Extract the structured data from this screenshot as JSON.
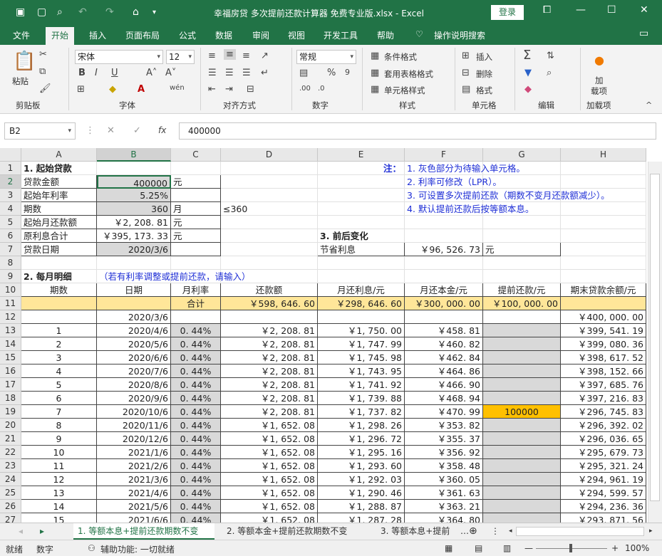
{
  "window": {
    "title": "幸福房贷 多次提前还款计算器 免费专业版.xlsx  -  Excel",
    "login_label": "登录"
  },
  "ribbon_tabs": [
    "文件",
    "开始",
    "插入",
    "页面布局",
    "公式",
    "数据",
    "审阅",
    "视图",
    "开发工具",
    "帮助",
    "操作说明搜索"
  ],
  "ribbon": {
    "paste_label": "粘贴",
    "clipboard_group": "剪贴板",
    "font_name": "宋体",
    "font_size": "12",
    "font_group": "字体",
    "align_group": "对齐方式",
    "number_format": "常规",
    "number_group": "数字",
    "cond_format": "条件格式",
    "table_format": "套用表格格式",
    "cell_style": "单元格样式",
    "style_group": "样式",
    "insert": "插入",
    "delete": "删除",
    "format": "格式",
    "cells_group": "单元格",
    "edit_group": "编辑",
    "addin_line1": "加",
    "addin_line2": "载项",
    "addin_group": "加载项"
  },
  "formula_bar": {
    "name_box": "B2",
    "formula": "400000"
  },
  "columns": [
    "A",
    "B",
    "C",
    "D",
    "E",
    "F",
    "G",
    "H"
  ],
  "rows": [
    {
      "n": "1",
      "a": "1. 起始贷款",
      "e": "注：",
      "f": "1. 灰色部分为待输入单元格。"
    },
    {
      "n": "2",
      "a": "贷款金额",
      "b": "400000",
      "c": "元",
      "f": "2. 利率可修改（LPR）。"
    },
    {
      "n": "3",
      "a": "起始年利率",
      "b": "5.25%",
      "f": "3. 可设置多次提前还款（期数不变月还款额减少）。"
    },
    {
      "n": "4",
      "a": "期数",
      "b": "360",
      "c": "月",
      "d": "≤360",
      "f": "4. 默认提前还款后按等额本息。"
    },
    {
      "n": "5",
      "a": "起始月还款额",
      "b": "￥2, 208. 81",
      "c": "元"
    },
    {
      "n": "6",
      "a": "原利息合计",
      "b": "￥395, 173. 33",
      "c": "元",
      "e": "3. 前后变化"
    },
    {
      "n": "7",
      "a": "贷款日期",
      "b": "2020/3/6",
      "e": "节省利息",
      "f": "￥96, 526. 73",
      "g": "元"
    },
    {
      "n": "8"
    },
    {
      "n": "9",
      "a": "2. 每月明细",
      "b": "（若有利率调整或提前还款，请输入）"
    },
    {
      "n": "10",
      "a": "期数",
      "b": "日期",
      "c": "月利率",
      "d": "还款额",
      "e": "月还利息/元",
      "f": "月还本金/元",
      "g": "提前还款/元",
      "h": "期末贷款余额/元"
    },
    {
      "n": "11",
      "c": "合计",
      "d": "￥598, 646. 60",
      "e": "￥298, 646. 60",
      "f": "￥300, 000. 00",
      "g": "￥100, 000. 00"
    },
    {
      "n": "12",
      "b": "2020/3/6",
      "h": "￥400, 000. 00"
    },
    {
      "n": "13",
      "a": "1",
      "b": "2020/4/6",
      "c": "0. 44%",
      "d": "￥2, 208. 81",
      "e": "￥1, 750. 00",
      "f": "￥458. 81",
      "h": "￥399, 541. 19"
    },
    {
      "n": "14",
      "a": "2",
      "b": "2020/5/6",
      "c": "0. 44%",
      "d": "￥2, 208. 81",
      "e": "￥1, 747. 99",
      "f": "￥460. 82",
      "h": "￥399, 080. 36"
    },
    {
      "n": "15",
      "a": "3",
      "b": "2020/6/6",
      "c": "0. 44%",
      "d": "￥2, 208. 81",
      "e": "￥1, 745. 98",
      "f": "￥462. 84",
      "h": "￥398, 617. 52"
    },
    {
      "n": "16",
      "a": "4",
      "b": "2020/7/6",
      "c": "0. 44%",
      "d": "￥2, 208. 81",
      "e": "￥1, 743. 95",
      "f": "￥464. 86",
      "h": "￥398, 152. 66"
    },
    {
      "n": "17",
      "a": "5",
      "b": "2020/8/6",
      "c": "0. 44%",
      "d": "￥2, 208. 81",
      "e": "￥1, 741. 92",
      "f": "￥466. 90",
      "h": "￥397, 685. 76"
    },
    {
      "n": "18",
      "a": "6",
      "b": "2020/9/6",
      "c": "0. 44%",
      "d": "￥2, 208. 81",
      "e": "￥1, 739. 88",
      "f": "￥468. 94",
      "h": "￥397, 216. 83"
    },
    {
      "n": "19",
      "a": "7",
      "b": "2020/10/6",
      "c": "0. 44%",
      "d": "￥2, 208. 81",
      "e": "￥1, 737. 82",
      "f": "￥470. 99",
      "g": "100000",
      "h": "￥296, 745. 83"
    },
    {
      "n": "20",
      "a": "8",
      "b": "2020/11/6",
      "c": "0. 44%",
      "d": "￥1, 652. 08",
      "e": "￥1, 298. 26",
      "f": "￥353. 82",
      "h": "￥296, 392. 02"
    },
    {
      "n": "21",
      "a": "9",
      "b": "2020/12/6",
      "c": "0. 44%",
      "d": "￥1, 652. 08",
      "e": "￥1, 296. 72",
      "f": "￥355. 37",
      "h": "￥296, 036. 65"
    },
    {
      "n": "22",
      "a": "10",
      "b": "2021/1/6",
      "c": "0. 44%",
      "d": "￥1, 652. 08",
      "e": "￥1, 295. 16",
      "f": "￥356. 92",
      "h": "￥295, 679. 73"
    },
    {
      "n": "23",
      "a": "11",
      "b": "2021/2/6",
      "c": "0. 44%",
      "d": "￥1, 652. 08",
      "e": "￥1, 293. 60",
      "f": "￥358. 48",
      "h": "￥295, 321. 24"
    },
    {
      "n": "24",
      "a": "12",
      "b": "2021/3/6",
      "c": "0. 44%",
      "d": "￥1, 652. 08",
      "e": "￥1, 292. 03",
      "f": "￥360. 05",
      "h": "￥294, 961. 19"
    },
    {
      "n": "25",
      "a": "13",
      "b": "2021/4/6",
      "c": "0. 44%",
      "d": "￥1, 652. 08",
      "e": "￥1, 290. 46",
      "f": "￥361. 63",
      "h": "￥294, 599. 57"
    },
    {
      "n": "26",
      "a": "14",
      "b": "2021/5/6",
      "c": "0. 44%",
      "d": "￥1, 652. 08",
      "e": "￥1, 288. 87",
      "f": "￥363. 21",
      "h": "￥294, 236. 36"
    },
    {
      "n": "27",
      "a": "15",
      "b": "2021/6/6",
      "c": "0. 44%",
      "d": "￥1, 652. 08",
      "e": "￥1, 287. 28",
      "f": "￥364. 80",
      "h": "￥293, 871. 56"
    }
  ],
  "sheet_tabs": [
    "1. 等额本息+提前还款期数不变",
    "2. 等额本金+提前还款期数不变",
    "3. 等额本息+提前"
  ],
  "status": {
    "ready": "就绪",
    "mode": "数字",
    "accessibility": "辅助功能: 一切就绪",
    "zoom": "100%"
  },
  "colors": {
    "brand": "#217346",
    "input_gray": "#d9d9d9",
    "total_yellow": "#ffe699",
    "prepay_orange": "#ffc000",
    "note_blue": "#1f2fd6"
  }
}
